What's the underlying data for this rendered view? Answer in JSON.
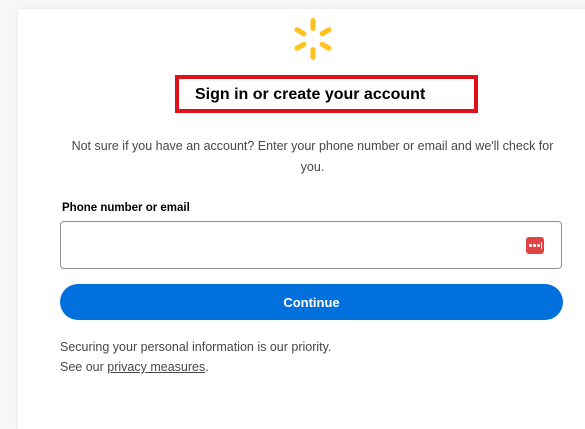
{
  "brand": {
    "logo_icon": "spark-icon",
    "logo_color": "#ffc220"
  },
  "header": {
    "title": "Sign in or create your account",
    "highlight_color": "#e0101a"
  },
  "intro": {
    "text": "Not sure if you have an account? Enter your phone number or email and we'll check for you."
  },
  "form": {
    "field_label": "Phone number or email",
    "field_value": "",
    "field_icon": "password-manager-icon",
    "continue_label": "Continue",
    "button_color": "#0071dc"
  },
  "footer": {
    "secure_text": "Securing your personal information is our priority.",
    "see_our": "See our",
    "privacy_link": "privacy measures",
    "period": "."
  }
}
